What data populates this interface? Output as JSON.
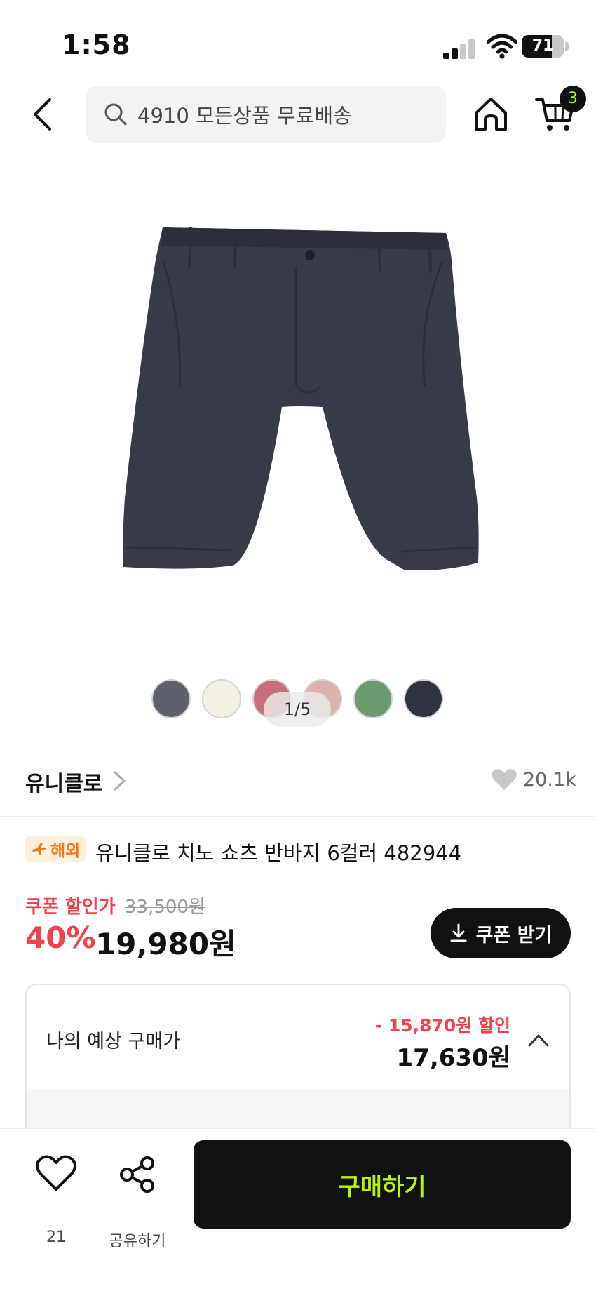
{
  "status_bar": {
    "time": "1:58",
    "battery": "71",
    "battery_level": 0.71
  },
  "header": {
    "search_text": "4910 모든상품 무료배송",
    "cart_count": "3"
  },
  "gallery": {
    "swatch_colors": [
      "#5c616b",
      "#f3efe2",
      "#c96f79",
      "#d9b3ad",
      "#6b9a71",
      "#2f3340"
    ],
    "page_indicator": "1/5",
    "product_color": "#363b47"
  },
  "brand": {
    "name": "유니클로",
    "like_count": "20.1k"
  },
  "product": {
    "badge": "해외",
    "title": "유니클로 치노 쇼츠 반바지 6컬러 482944"
  },
  "price": {
    "coupon_label": "쿠폰 할인가",
    "original": "33,500원",
    "discount_rate": "40%",
    "sale": "19,980원",
    "coupon_button": "쿠폰 받기"
  },
  "estimate": {
    "label": "나의 예상 구매가",
    "discount": "- 15,870원 할인",
    "price": "17,630원"
  },
  "bottom_bar": {
    "wish_count": "21",
    "share_label": "공유하기",
    "buy_label": "구매하기"
  },
  "colors": {
    "accent_red": "#f2424e",
    "buy_text": "#b7f500",
    "dark": "#111111"
  }
}
